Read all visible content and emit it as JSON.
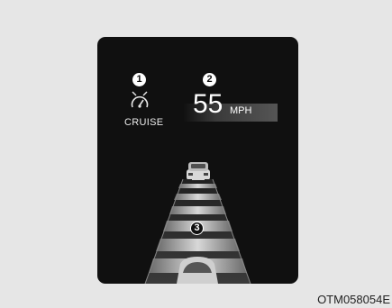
{
  "cluster": {
    "callouts": [
      "1",
      "2",
      "3"
    ],
    "cruise_icon": "cruise-speedometer-icon",
    "cruise_label": "CRUISE",
    "speed_value": "55",
    "speed_unit": "MPH",
    "lead_vehicle_icon": "lead-car-icon",
    "own_vehicle_icon": "own-car-icon",
    "distance_icon": "following-distance-bars-icon"
  },
  "caption": "OTM058054E"
}
